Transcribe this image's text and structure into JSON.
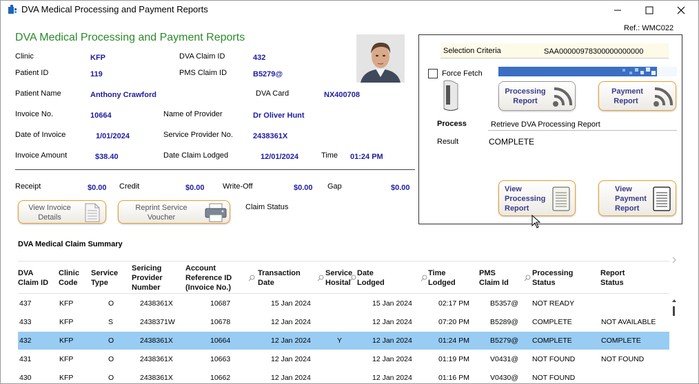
{
  "window": {
    "title": "DVA  Medical Processing and Payment Reports",
    "ref": "Ref.: WMC022"
  },
  "header": {
    "heading": "DVA  Medical Processing and Payment Reports"
  },
  "fields": {
    "clinic_label": "Clinic",
    "clinic": "KFP",
    "dva_claim_id_label": "DVA Claim ID",
    "dva_claim_id": "432",
    "patient_id_label": "Patient ID",
    "patient_id": "119",
    "pms_claim_id_label": "PMS Claim ID",
    "pms_claim_id": "B5279@",
    "patient_name_label": "Patient Name",
    "patient_name": "Anthony Crawford",
    "dva_card_label": "DVA Card",
    "dva_card": "NX400708",
    "invoice_no_label": "Invoice No.",
    "invoice_no": "10664",
    "provider_name_label": "Name of Provider",
    "provider_name": "Dr Oliver Hunt",
    "invoice_date_label": "Date of Invoice",
    "invoice_date": "1/01/2024",
    "provider_no_label": "Service Provider No.",
    "provider_no": "2438361X",
    "invoice_amount_label": "Invoice Amount",
    "invoice_amount": "$38.40",
    "date_lodged_label": "Date Claim Lodged",
    "date_lodged": "12/01/2024",
    "time_label": "Time",
    "time": "01:24 PM",
    "receipt_label": "Receipt",
    "receipt": "$0.00",
    "credit_label": "Credit",
    "credit": "$0.00",
    "writeoff_label": "Write-Off",
    "writeoff": "$0.00",
    "gap_label": "Gap",
    "gap": "$0.00",
    "claim_status_label": "Claim Status"
  },
  "buttons": {
    "view_invoice_l1": "View Invoice",
    "view_invoice_l2": "Details",
    "reprint_l1": "Reprint Service",
    "reprint_l2": "Voucher",
    "processing_report_l1": "Processing",
    "processing_report_l2": "Report",
    "payment_report_l1": "Payment",
    "payment_report_l2": "Report",
    "view_processing_l1": "View",
    "view_processing_l2": "Processing",
    "view_processing_l3": "Report",
    "view_payment_l1": "View",
    "view_payment_l2": "Payment",
    "view_payment_l3": "Report"
  },
  "panel": {
    "selection_label": "Selection Criteria",
    "selection_value": "SAA00000978300000000000",
    "force_fetch_label": "Force Fetch",
    "process_label": "Process",
    "process_value": "Retrieve DVA Processing Report",
    "result_label": "Result",
    "result_value": "COMPLETE"
  },
  "summary": {
    "title": "DVA Medical Claim Summary",
    "columns": [
      [
        "DVA",
        "Claim ID"
      ],
      [
        "Clinic",
        "Code"
      ],
      [
        "Service",
        "Type"
      ],
      [
        "Sericing",
        "Provider",
        "Number"
      ],
      [
        "Account",
        "Reference ID",
        "(Invoice No.)"
      ],
      [
        "Transaction",
        "Date"
      ],
      [
        "Service",
        "Hosital"
      ],
      [
        "Date",
        "Lodged"
      ],
      [
        "Time",
        "Lodged"
      ],
      [
        "PMS",
        "Claim Id"
      ],
      [
        "Processing",
        "Status"
      ],
      [
        "Report",
        "Status"
      ]
    ],
    "rows": [
      [
        "437",
        "KFP",
        "O",
        "2438361X",
        "10687",
        "15 Jan 2024",
        "",
        "15 Jan 2024",
        "02:17 PM",
        "B5357@",
        "NOT READY",
        ""
      ],
      [
        "433",
        "KFP",
        "S",
        "2438371W",
        "10678",
        "12 Jan 2024",
        "",
        "12 Jan 2024",
        "07:20 PM",
        "B5289@",
        "COMPLETE",
        "NOT AVAILABLE"
      ],
      [
        "432",
        "KFP",
        "O",
        "2438361X",
        "10664",
        "12 Jan 2024",
        "Y",
        "12 Jan 2024",
        "01:24 PM",
        "B5279@",
        "COMPLETE",
        "COMPLETE"
      ],
      [
        "431",
        "KFP",
        "O",
        "2438361X",
        "10663",
        "12 Jan 2024",
        "",
        "12 Jan 2024",
        "01:19 PM",
        "V0431@",
        "NOT FOUND",
        "NOT FOUND"
      ],
      [
        "430",
        "KFP",
        "O",
        "2438361X",
        "10662",
        "12 Jan 2024",
        "",
        "12 Jan 2024",
        "01:16 PM",
        "V0430@",
        "NOT FOUND",
        ""
      ]
    ],
    "selected_row": 2
  },
  "icons": [
    "app-icon",
    "minimize-icon",
    "maximize-icon",
    "close-icon",
    "document-icon",
    "printer-icon",
    "card-reader-icon",
    "signal-icon",
    "report-sheet-icon",
    "search-icon",
    "scroll-arrow-icon",
    "mouse-cursor-icon"
  ],
  "colors": {
    "heading": "#2a8a2a",
    "value": "#1c1ca0",
    "button_border": "#e8a030",
    "selected_row": "#99ccf2",
    "progress": "#3a6fc4"
  }
}
